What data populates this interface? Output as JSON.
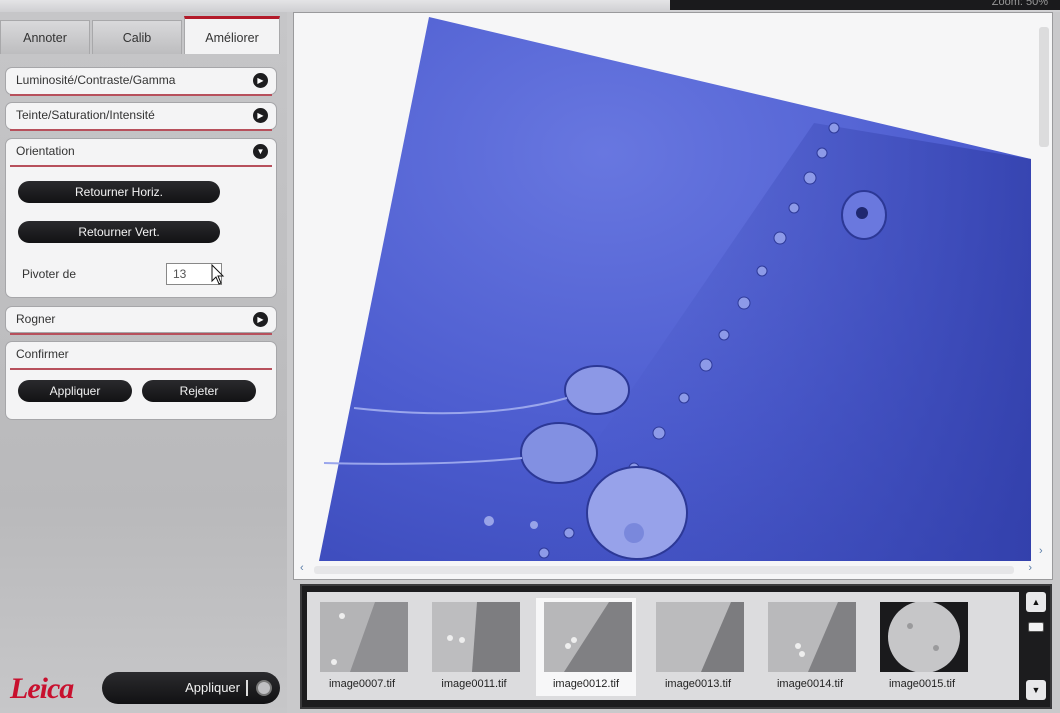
{
  "topbar": {
    "right_text": "Zoom: 50%"
  },
  "tabs": [
    {
      "label": "Annoter"
    },
    {
      "label": "Calib"
    },
    {
      "label": "Améliorer"
    }
  ],
  "sections": {
    "luminosite": {
      "title": "Luminosité/Contraste/Gamma"
    },
    "teinte": {
      "title": "Teinte/Saturation/Intensité"
    },
    "orientation": {
      "title": "Orientation",
      "flip_h": "Retourner Horiz.",
      "flip_v": "Retourner Vert.",
      "rotate_label": "Pivoter de",
      "rotate_value": "13"
    },
    "rogner": {
      "title": "Rogner"
    },
    "confirmer": {
      "title": "Confirmer",
      "apply": "Appliquer",
      "reject": "Rejeter"
    }
  },
  "footer": {
    "brand": "Leica",
    "apply": "Appliquer"
  },
  "thumbnails": [
    {
      "name": "image0007.tif"
    },
    {
      "name": "image0011.tif"
    },
    {
      "name": "image0012.tif"
    },
    {
      "name": "image0013.tif"
    },
    {
      "name": "image0014.tif"
    },
    {
      "name": "image0015.tif"
    }
  ],
  "colors": {
    "accent": "#b31b2a",
    "image_blue": "#4d5fd2"
  }
}
